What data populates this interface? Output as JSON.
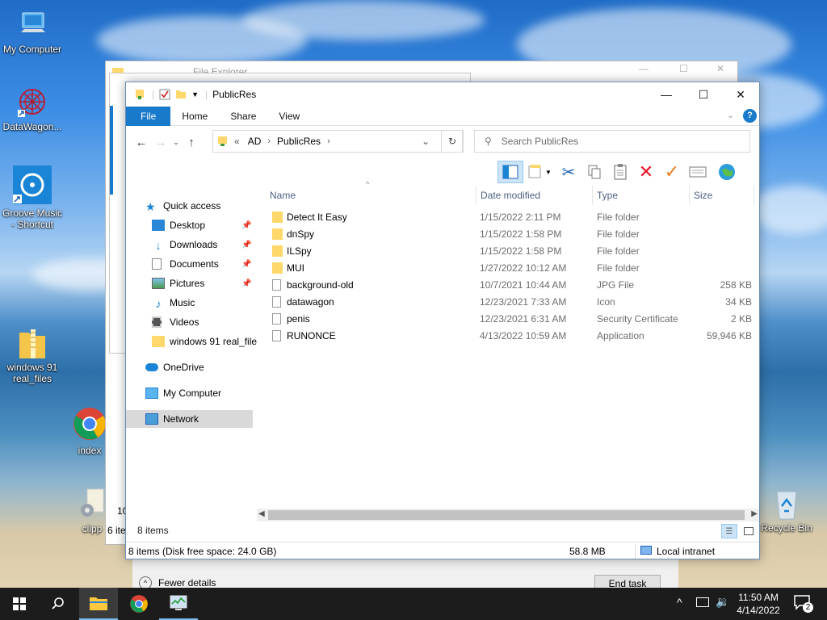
{
  "desktop": {
    "icons": [
      {
        "label": "My Computer"
      },
      {
        "label": "DataWagon..."
      },
      {
        "label": "Groove Music - Shortcut"
      },
      {
        "label": "windows 91 real_files"
      },
      {
        "label": "index"
      },
      {
        "label": "clipp"
      },
      {
        "label": "Recycle Bin"
      }
    ]
  },
  "bg_windows": {
    "back_title": "File Explorer",
    "count_fragment": "6 ite",
    "num_fragment": "10",
    "fewer_details": "Fewer details",
    "end_task": "End task"
  },
  "window": {
    "title": "PublicRes",
    "ribbon_tabs": [
      "File",
      "Home",
      "Share",
      "View"
    ],
    "address": {
      "root": "«",
      "crumbs": [
        "AD",
        "PublicRes"
      ]
    },
    "search_placeholder": "Search PublicRes",
    "nav": {
      "quick_access": "Quick access",
      "items": [
        "Desktop",
        "Downloads",
        "Documents",
        "Pictures",
        "Music",
        "Videos",
        "windows 91 real_file"
      ],
      "onedrive": "OneDrive",
      "my_computer": "My Computer",
      "network": "Network"
    },
    "columns": {
      "name": "Name",
      "date": "Date modified",
      "type": "Type",
      "size": "Size"
    },
    "files": [
      {
        "name": "Detect It Easy",
        "date": "1/15/2022 2:11 PM",
        "type": "File folder",
        "size": "",
        "kind": "folder"
      },
      {
        "name": "dnSpy",
        "date": "1/15/2022 1:58 PM",
        "type": "File folder",
        "size": "",
        "kind": "folder"
      },
      {
        "name": "ILSpy",
        "date": "1/15/2022 1:58 PM",
        "type": "File folder",
        "size": "",
        "kind": "folder"
      },
      {
        "name": "MUI",
        "date": "1/27/2022 10:12 AM",
        "type": "File folder",
        "size": "",
        "kind": "folder"
      },
      {
        "name": "background-old",
        "date": "10/7/2021 10:44 AM",
        "type": "JPG File",
        "size": "258 KB",
        "kind": "file"
      },
      {
        "name": "datawagon",
        "date": "12/23/2021 7:33 AM",
        "type": "Icon",
        "size": "34 KB",
        "kind": "file"
      },
      {
        "name": "penis",
        "date": "12/23/2021 6:31 AM",
        "type": "Security Certificate",
        "size": "2 KB",
        "kind": "file"
      },
      {
        "name": "RUNONCE",
        "date": "4/13/2022 10:59 AM",
        "type": "Application",
        "size": "59,946 KB",
        "kind": "file"
      }
    ],
    "item_count": "8 items",
    "status": {
      "left": "8 items (Disk free space: 24.0 GB)",
      "size": "58.8 MB",
      "zone": "Local intranet"
    }
  },
  "taskbar": {
    "time": "11:50 AM",
    "date": "4/14/2022",
    "notifications": "2"
  },
  "colors": {
    "accent": "#1979ca",
    "folder": "#ffd86b",
    "delete": "#e81123",
    "check": "#f07b1a"
  }
}
